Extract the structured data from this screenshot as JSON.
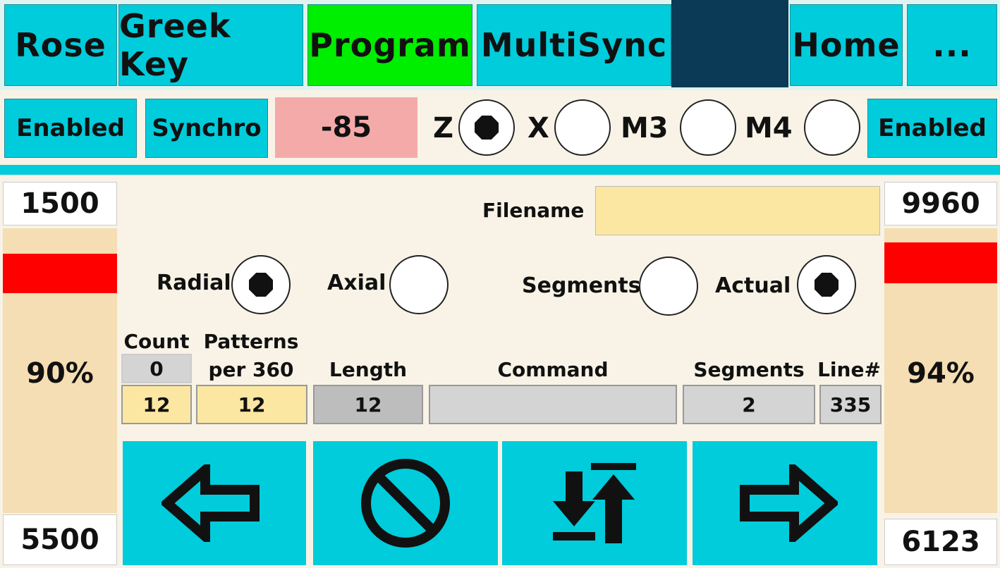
{
  "nav": {
    "tabs": [
      {
        "label": "Rose"
      },
      {
        "label": "Greek Key"
      },
      {
        "label": "Program"
      },
      {
        "label": "MultiSync"
      }
    ],
    "home_label": "Home",
    "more_label": "..."
  },
  "controls": {
    "left_enabled": "Enabled",
    "synchro": "Synchro",
    "value": "-85",
    "axes": [
      {
        "label": "Z",
        "selected": true
      },
      {
        "label": "X",
        "selected": false
      },
      {
        "label": "M3",
        "selected": false
      },
      {
        "label": "M4",
        "selected": false
      }
    ],
    "right_enabled": "Enabled"
  },
  "left_panel": {
    "top_value": "1500",
    "percent": "90%",
    "bottom_value": "5500",
    "level": 0.9
  },
  "right_panel": {
    "top_value": "9960",
    "percent": "94%",
    "bottom_value": "6123",
    "level": 0.94
  },
  "program": {
    "filename_label": "Filename",
    "filename_value": "",
    "mode_options": [
      {
        "label": "Radial",
        "selected": true
      },
      {
        "label": "Axial",
        "selected": false
      }
    ],
    "display_options": [
      {
        "label": "Segments",
        "selected": false
      },
      {
        "label": "Actual",
        "selected": true
      }
    ],
    "table": {
      "count_label": "Count",
      "count_value": "0",
      "count_setting": "12",
      "patterns_label_1": "Patterns",
      "patterns_label_2": "per 360",
      "patterns_value": "12",
      "length_label": "Length",
      "length_value": "12",
      "command_label": "Command",
      "command_value": "",
      "segments_label": "Segments",
      "segments_value": "2",
      "line_label": "Line#",
      "line_value": "335"
    }
  },
  "actions": [
    {
      "icon": "arrow-left-icon"
    },
    {
      "icon": "stop-icon"
    },
    {
      "icon": "up-down-limit-icon"
    },
    {
      "icon": "arrow-right-icon"
    }
  ],
  "colors": {
    "button": "#00ccdb",
    "active_tab": "#00ee00",
    "nav_fill": "#0a3a55",
    "value_field": "#f5aaaa",
    "filename_field": "#fbe7a1",
    "gauge": "#f5deb3",
    "gauge_marker": "#ff0000"
  }
}
